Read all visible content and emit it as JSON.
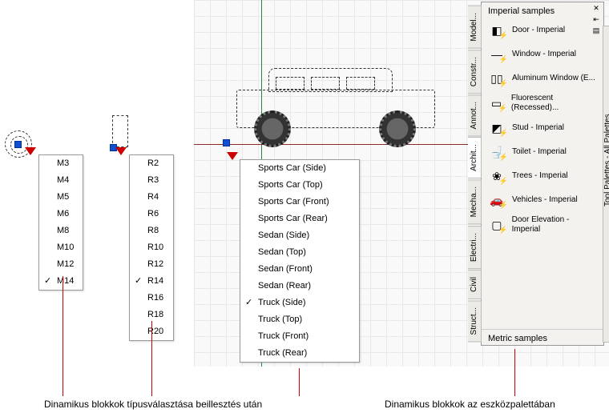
{
  "dropdowns": {
    "m": {
      "items": [
        "M3",
        "M4",
        "M5",
        "M6",
        "M8",
        "M10",
        "M12",
        "M14"
      ],
      "checked": "M14"
    },
    "r": {
      "items": [
        "R2",
        "R3",
        "R4",
        "R6",
        "R8",
        "R10",
        "R12",
        "R14",
        "R16",
        "R18",
        "R20"
      ],
      "checked": "R14"
    },
    "vehicle": {
      "items": [
        "Sports Car (Side)",
        "Sports Car (Top)",
        "Sports Car (Front)",
        "Sports Car (Rear)",
        "Sedan (Side)",
        "Sedan (Top)",
        "Sedan (Front)",
        "Sedan (Rear)",
        "Truck (Side)",
        "Truck (Top)",
        "Truck (Front)",
        "Truck (Rear)"
      ],
      "checked": "Truck (Side)"
    }
  },
  "palette": {
    "group1": "Imperial samples",
    "group2": "Metric samples",
    "side_strip": "Tool Palettes - All Palettes",
    "items": [
      {
        "label": "Door - Imperial",
        "icon": "door-icon"
      },
      {
        "label": "Window - Imperial",
        "icon": "window-icon"
      },
      {
        "label": "Aluminum Window (E...",
        "icon": "alum-window-icon"
      },
      {
        "label": "Fluorescent (Recessed)...",
        "icon": "light-icon"
      },
      {
        "label": "Stud - Imperial",
        "icon": "stud-icon"
      },
      {
        "label": "Toilet - Imperial",
        "icon": "toilet-icon"
      },
      {
        "label": "Trees - Imperial",
        "icon": "tree-icon"
      },
      {
        "label": "Vehicles - Imperial",
        "icon": "vehicle-icon"
      },
      {
        "label": "Door Elevation - Imperial",
        "icon": "door-elev-icon"
      }
    ],
    "tabs": [
      "Model...",
      "Constr...",
      "Annot...",
      "Archit...",
      "Mecha...",
      "Electri...",
      "Civil",
      "Struct..."
    ],
    "active_tab": "Archit..."
  },
  "captions": {
    "left": "Dinamikus blokkok  típusválasztása beillesztés után",
    "right": "Dinamikus blokkok az eszközpalettában"
  }
}
